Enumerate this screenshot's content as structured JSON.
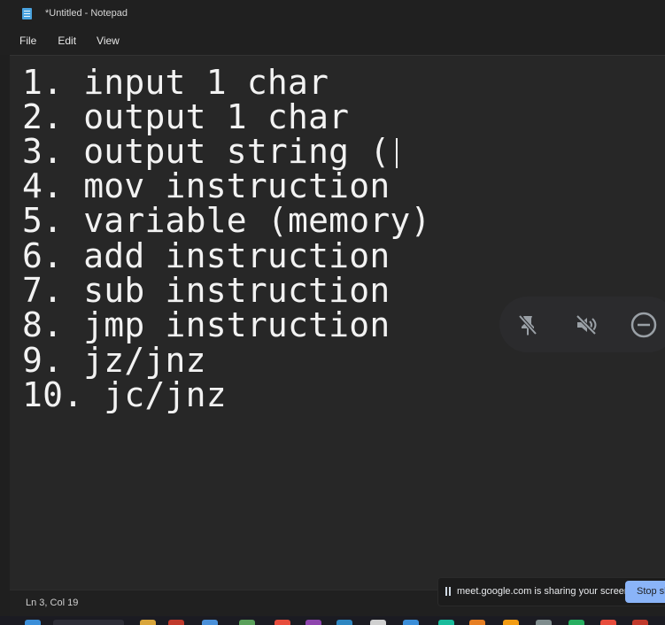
{
  "window": {
    "title": "*Untitled - Notepad",
    "icon": "notepad-icon"
  },
  "menu": {
    "file": "File",
    "edit": "Edit",
    "view": "View"
  },
  "editor": {
    "lines": [
      "1. input 1 char",
      "2. output 1 char",
      "3. output string (",
      "4. mov instruction",
      "5. variable (memory)",
      "6. add instruction",
      "7. sub instruction",
      "8. jmp instruction",
      "9. jz/jnz",
      "10. jc/jnz"
    ]
  },
  "meet_controls": {
    "icons": [
      "pin-off-icon",
      "volume-off-icon",
      "minus-circle-icon"
    ]
  },
  "status": {
    "position": "Ln 3, Col 19"
  },
  "screen_share": {
    "message": "meet.google.com is sharing your screen.",
    "stop_label": "Stop sh"
  },
  "colors": {
    "editor_bg": "#272727",
    "text": "#f2f2f2",
    "stop_button": "#8ab4f8"
  }
}
